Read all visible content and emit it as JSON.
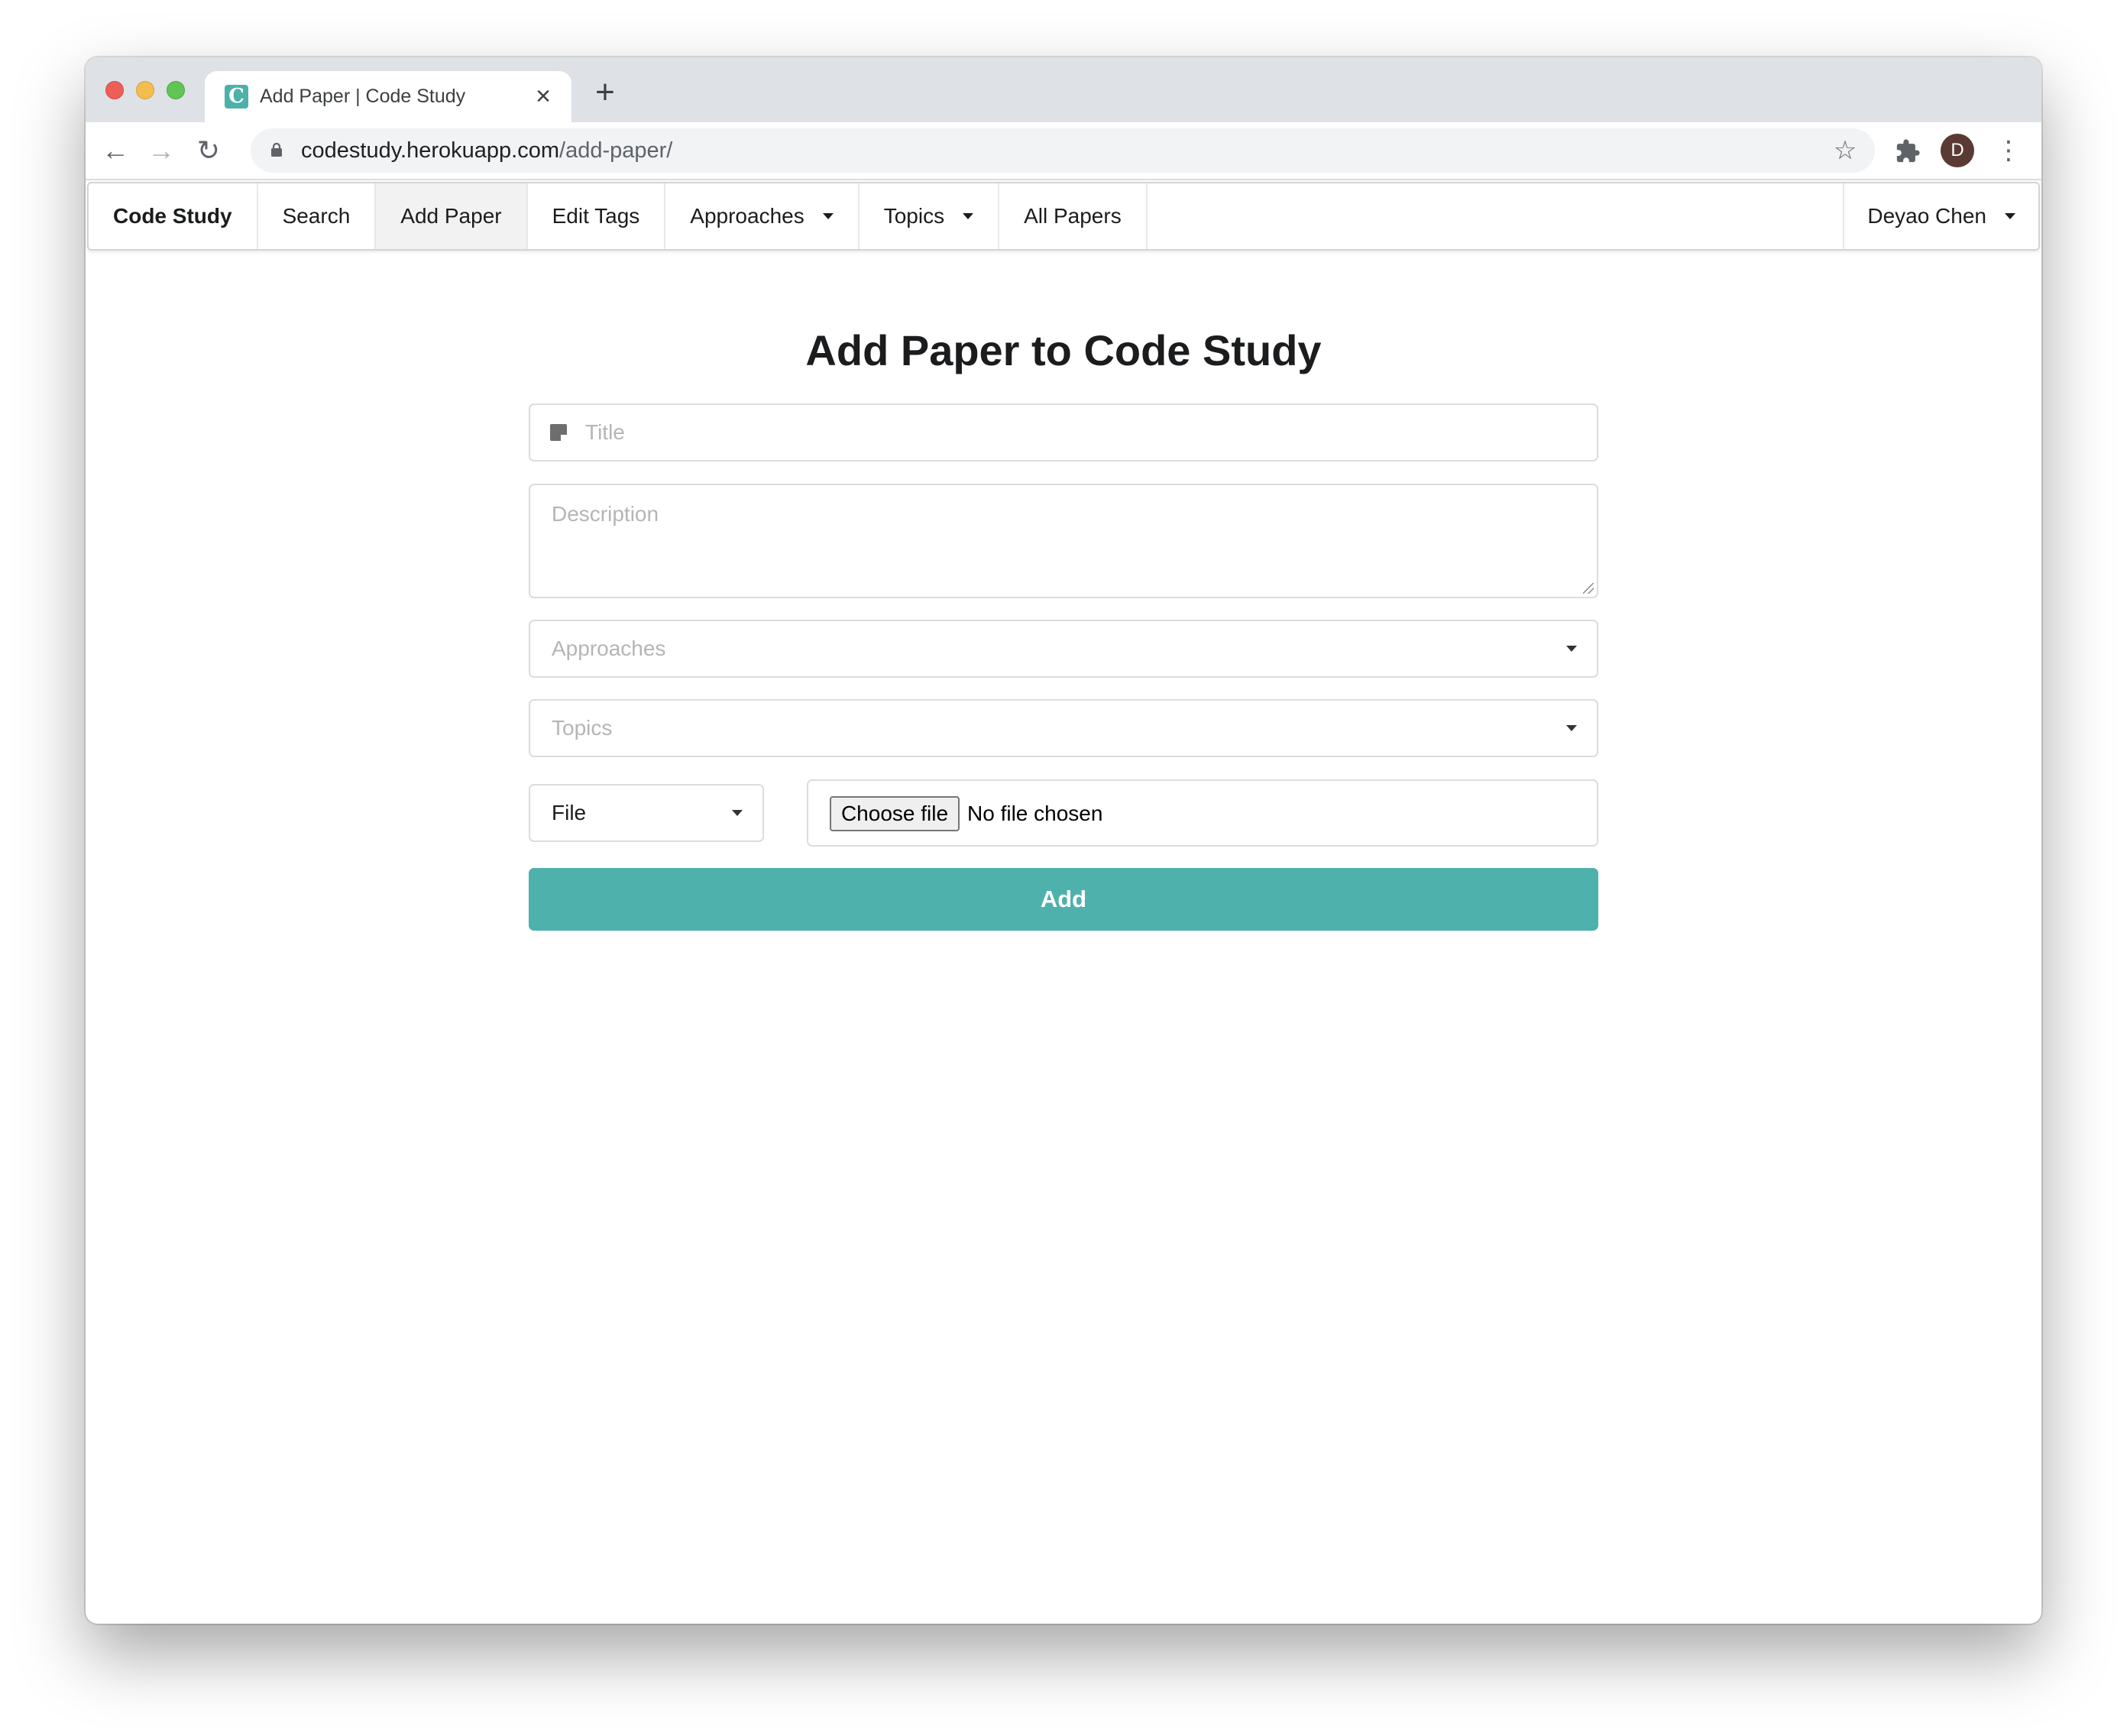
{
  "browser": {
    "tab_title": "Add Paper | Code Study",
    "favicon_letter": "C",
    "url_host": "codestudy.herokuapp.com",
    "url_path": "/add-paper/",
    "profile_initial": "D"
  },
  "navbar": {
    "brand": "Code Study",
    "items": [
      {
        "label": "Search",
        "dropdown": false,
        "active": false
      },
      {
        "label": "Add Paper",
        "dropdown": false,
        "active": true
      },
      {
        "label": "Edit Tags",
        "dropdown": false,
        "active": false
      },
      {
        "label": "Approaches",
        "dropdown": true,
        "active": false
      },
      {
        "label": "Topics",
        "dropdown": true,
        "active": false
      },
      {
        "label": "All Papers",
        "dropdown": false,
        "active": false
      }
    ],
    "user": "Deyao Chen"
  },
  "form": {
    "heading": "Add Paper to Code Study",
    "title_placeholder": "Title",
    "description_placeholder": "Description",
    "approaches_placeholder": "Approaches",
    "topics_placeholder": "Topics",
    "source_type": "File",
    "choose_file_label": "Choose file",
    "file_status": "No file chosen",
    "submit_label": "Add"
  },
  "colors": {
    "accent": "#4fb1ab",
    "favicon": "#4db1a9"
  }
}
